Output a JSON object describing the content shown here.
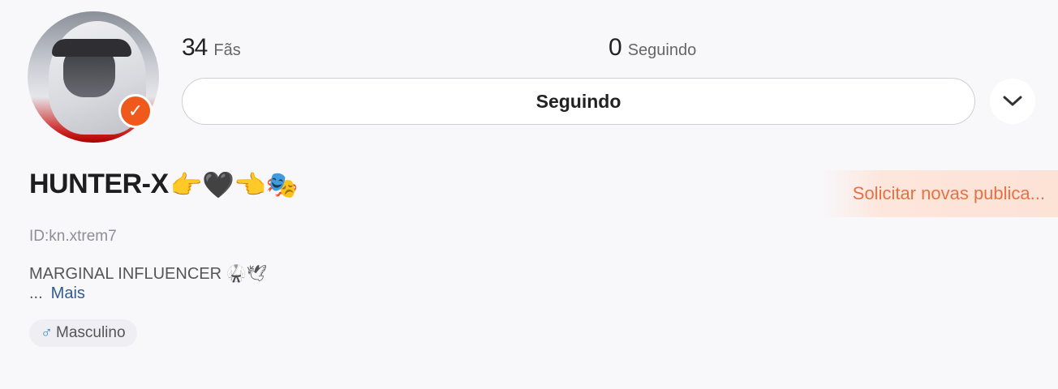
{
  "profile": {
    "name": "HUNTER-X",
    "name_emoji": "👉🖤👈🎭",
    "user_id": "ID:kn.xtrem7",
    "bio": "MARGINAL INFLUENCER 🥋🕊",
    "bio_ellipsis": "...",
    "more_label": "Mais",
    "gender_icon": "♂",
    "gender_label": "Masculino",
    "verified_icon": "✓"
  },
  "stats": {
    "fans_count": "34",
    "fans_label": "Fãs",
    "following_count": "0",
    "following_label": "Seguindo"
  },
  "actions": {
    "follow_button_label": "Seguindo",
    "dropdown_icon": "chevron-down-icon",
    "request_button_label": "Solicitar novas publica..."
  },
  "colors": {
    "accent": "#ef5a1c",
    "link": "#2f5b9a",
    "request_text": "#e87142",
    "male_icon": "#2b86d8"
  }
}
